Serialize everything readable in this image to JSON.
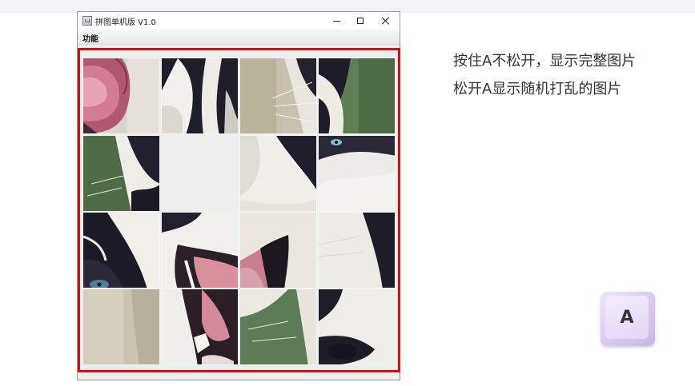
{
  "window": {
    "title": "拼图单机版 V1.0",
    "menu_items": [
      "功能"
    ]
  },
  "puzzle": {
    "image_subject": "husky dog face, shuffled into tiles",
    "grid": "4x4",
    "blank_tile": {
      "row": 2,
      "col": 2
    }
  },
  "annotations": {
    "line1": "按住A不松开，显示完整图片",
    "line2": "松开A显示随机打乱的图片"
  },
  "key": {
    "label": "A"
  },
  "colors": {
    "highlight_border": "#d40f14",
    "keycap": "#e3d6f6",
    "text": "#333333"
  }
}
